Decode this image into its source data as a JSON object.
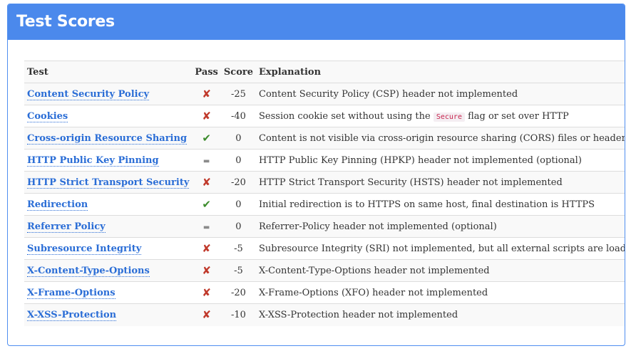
{
  "panel": {
    "title": "Test Scores",
    "header_color": "#4b89ec"
  },
  "table": {
    "headers": {
      "test": "Test",
      "pass": "Pass",
      "score": "Score",
      "explanation": "Explanation"
    },
    "rows": [
      {
        "test": "Content Security Policy",
        "pass": "fail",
        "pass_glyph": "✘",
        "score": "-25",
        "explanation": "Content Security Policy (CSP) header not implemented",
        "info_icon": "info-circle-icon"
      },
      {
        "test": "Cookies",
        "pass": "fail",
        "pass_glyph": "✘",
        "score": "-40",
        "explanation_before": "Session cookie set without using the",
        "explanation_code": "Secure",
        "explanation_after": "flag or set over HTTP",
        "info_icon": "info-circle-icon"
      },
      {
        "test": "Cross-origin Resource Sharing",
        "pass": "pass",
        "pass_glyph": "✔",
        "score": "0",
        "explanation": "Content is not visible via cross-origin resource sharing (CORS) files or headers",
        "info_icon": "info-circle-icon"
      },
      {
        "test": "HTTP Public Key Pinning",
        "pass": "na",
        "pass_glyph": "▬",
        "score": "0",
        "explanation": "HTTP Public Key Pinning (HPKP) header not implemented (optional)",
        "info_icon": "info-circle-icon"
      },
      {
        "test": "HTTP Strict Transport Security",
        "pass": "fail",
        "pass_glyph": "✘",
        "score": "-20",
        "explanation": "HTTP Strict Transport Security (HSTS) header not implemented",
        "info_icon": "info-circle-icon"
      },
      {
        "test": "Redirection",
        "pass": "pass",
        "pass_glyph": "✔",
        "score": "0",
        "explanation": "Initial redirection is to HTTPS on same host, final destination is HTTPS",
        "info_icon": "info-circle-icon"
      },
      {
        "test": "Referrer Policy",
        "pass": "na",
        "pass_glyph": "▬",
        "score": "0",
        "explanation": "Referrer-Policy header not implemented (optional)",
        "info_icon": "info-circle-icon"
      },
      {
        "test": "Subresource Integrity",
        "pass": "fail",
        "pass_glyph": "✘",
        "score": "-5",
        "explanation": "Subresource Integrity (SRI) not implemented, but all external scripts are loaded over HTTPS",
        "info_icon": "info-circle-icon"
      },
      {
        "test": "X-Content-Type-Options",
        "pass": "fail",
        "pass_glyph": "✘",
        "score": "-5",
        "explanation": "X-Content-Type-Options header not implemented",
        "info_icon": "info-circle-icon"
      },
      {
        "test": "X-Frame-Options",
        "pass": "fail",
        "pass_glyph": "✘",
        "score": "-20",
        "explanation": "X-Frame-Options (XFO) header not implemented",
        "info_icon": "info-circle-icon"
      },
      {
        "test": "X-XSS-Protection",
        "pass": "fail",
        "pass_glyph": "✘",
        "score": "-10",
        "explanation": "X-XSS-Protection header not implemented",
        "info_icon": "info-circle-icon"
      }
    ]
  },
  "colors": {
    "link": "#2a6dd6",
    "fail": "#c0392b",
    "pass": "#3c8c2c",
    "neutral": "#8a8a8a"
  }
}
